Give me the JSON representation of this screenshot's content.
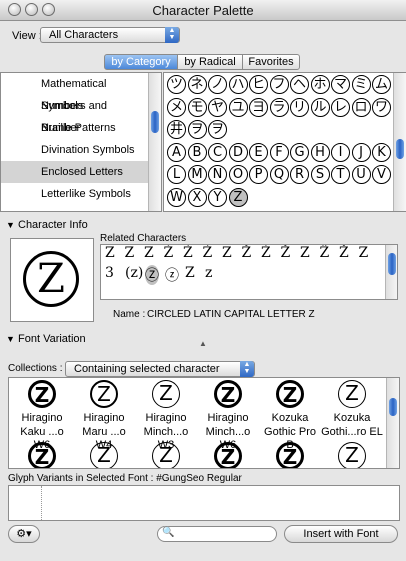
{
  "window": {
    "title": "Character Palette"
  },
  "view": {
    "label": "View :",
    "value": "All Characters"
  },
  "tabs": [
    {
      "label": "by Category"
    },
    {
      "label": "by Radical"
    },
    {
      "label": "Favorites"
    }
  ],
  "categories": [
    {
      "label": "Mathematical Symbols"
    },
    {
      "label": "Numbers and Number"
    },
    {
      "label": "Braille Patterns"
    },
    {
      "label": "Divination Symbols"
    },
    {
      "label": "Enclosed Letters"
    },
    {
      "label": "Letterlike Symbols"
    }
  ],
  "glyph_grid": [
    [
      "ツ",
      "ネ",
      "ノ",
      "ハ",
      "ヒ",
      "フ",
      "ヘ",
      "ホ",
      "マ",
      "ミ",
      "ム"
    ],
    [
      "メ",
      "モ",
      "ヤ",
      "ユ",
      "ヨ",
      "ラ",
      "リ",
      "ル",
      "レ",
      "ロ",
      "ワ"
    ],
    [
      "井",
      "ヲ",
      "ヲ"
    ],
    [
      "A",
      "B",
      "C",
      "D",
      "E",
      "F",
      "G",
      "H",
      "I",
      "J",
      "K"
    ],
    [
      "L",
      "M",
      "N",
      "O",
      "P",
      "Q",
      "R",
      "S",
      "T",
      "U",
      "V"
    ],
    [
      "W",
      "X",
      "Y",
      "Z"
    ]
  ],
  "character_info": {
    "header": "Character Info",
    "preview_glyph": "Z",
    "related_label": "Related Characters",
    "related_row1": [
      "Z",
      "Z",
      "Z",
      "Ż",
      "Ź",
      "Ź",
      "Z",
      "Ž",
      "Ż",
      "Ž",
      "Z",
      "Ẑ",
      "Ž",
      "Z"
    ],
    "related_row2": [
      "3",
      "(z)",
      "Ⓩ",
      "ⓩ",
      "Z",
      "z"
    ],
    "name_label": "Name :",
    "name_value": "CIRCLED LATIN CAPITAL LETTER Z"
  },
  "font_variation": {
    "header": "Font Variation",
    "collections_label": "Collections :",
    "collections_value": "Containing selected character",
    "fonts": [
      {
        "line1": "Hiragino",
        "line2": "Kaku ...o W6"
      },
      {
        "line1": "Hiragino",
        "line2": "Maru ...o W4"
      },
      {
        "line1": "Hiragino",
        "line2": "Minch...o W3"
      },
      {
        "line1": "Hiragino",
        "line2": "Minch...o W6"
      },
      {
        "line1": "Kozuka",
        "line2": "Gothic Pro B"
      },
      {
        "line1": "Kozuka",
        "line2": "Gothi...ro EL"
      }
    ],
    "sample_glyph": "Z",
    "glyph_variants_label": "Glyph Variants in Selected Font : #GungSeo Regular"
  },
  "bottom": {
    "gear_icon": "gear-icon",
    "search_placeholder": "",
    "insert_button": "Insert with Font"
  }
}
